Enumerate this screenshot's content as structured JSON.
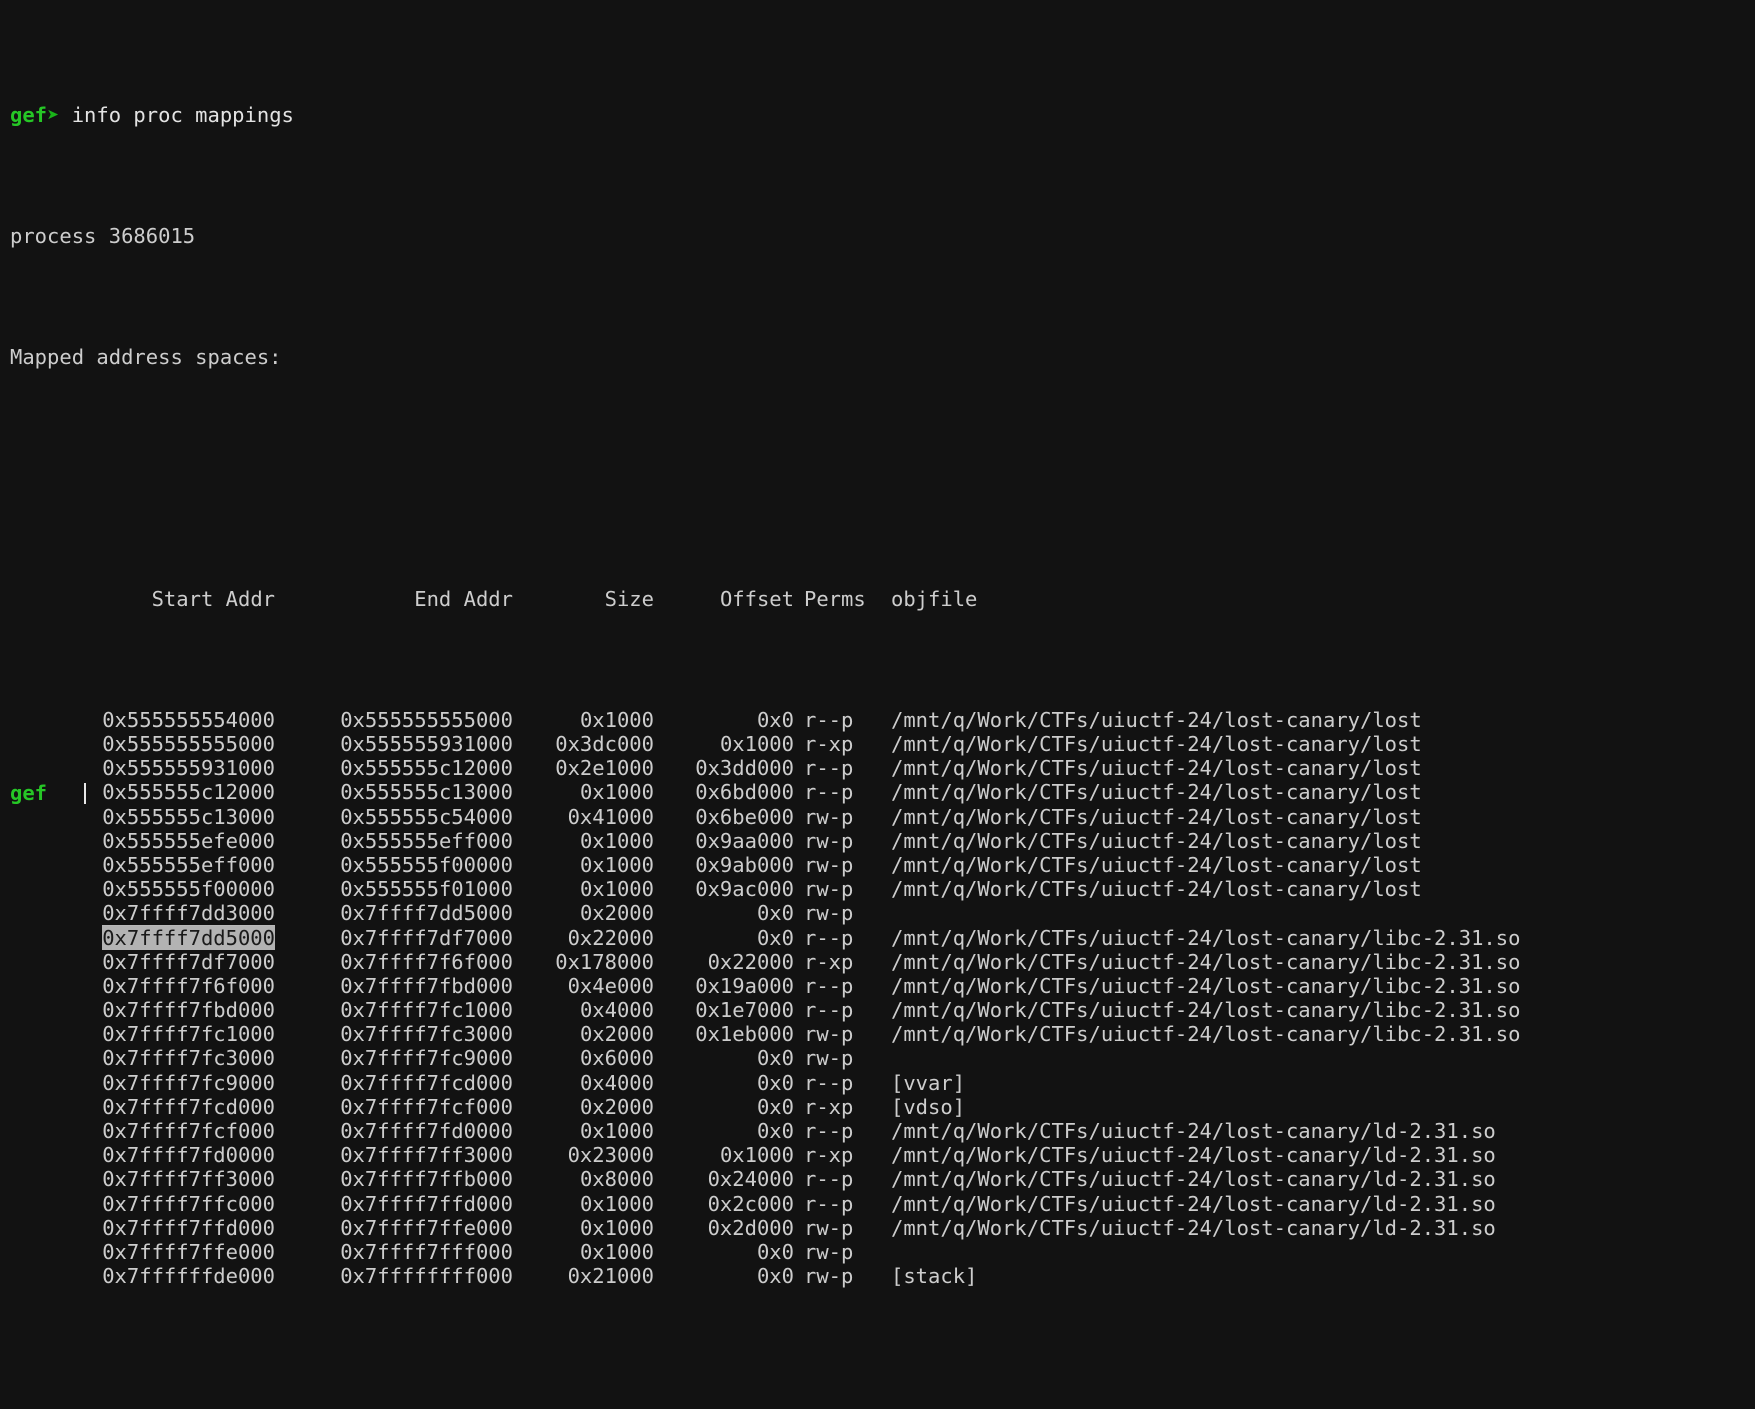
{
  "terminal": {
    "title": "gdb gef terminal",
    "background_color": "#121212",
    "foreground_color": "#cdcdcd",
    "prompt_color": "#26c726",
    "selection_color": "#b3b3b3",
    "prompt": {
      "label": "gef",
      "arrow": "➤",
      "command": "info proc mappings"
    },
    "output": {
      "process_line": "process 3686015",
      "mapped_header": "Mapped address spaces:",
      "blank_line": ""
    },
    "columns": {
      "start": "Start Addr",
      "end": "End Addr",
      "size": "Size",
      "offset": "Offset",
      "perms": "Perms",
      "objfile": "objfile"
    },
    "rows": [
      {
        "start": "0x555555554000",
        "end": "0x555555555000",
        "size": "0x1000",
        "offset": "0x0",
        "perms": "r--p",
        "objfile": "/mnt/q/Work/CTFs/uiuctf-24/lost-canary/lost"
      },
      {
        "start": "0x555555555000",
        "end": "0x555555931000",
        "size": "0x3dc000",
        "offset": "0x1000",
        "perms": "r-xp",
        "objfile": "/mnt/q/Work/CTFs/uiuctf-24/lost-canary/lost"
      },
      {
        "start": "0x555555931000",
        "end": "0x555555c12000",
        "size": "0x2e1000",
        "offset": "0x3dd000",
        "perms": "r--p",
        "objfile": "/mnt/q/Work/CTFs/uiuctf-24/lost-canary/lost"
      },
      {
        "start": "0x555555c12000",
        "end": "0x555555c13000",
        "size": "0x1000",
        "offset": "0x6bd000",
        "perms": "r--p",
        "objfile": "/mnt/q/Work/CTFs/uiuctf-24/lost-canary/lost"
      },
      {
        "start": "0x555555c13000",
        "end": "0x555555c54000",
        "size": "0x41000",
        "offset": "0x6be000",
        "perms": "rw-p",
        "objfile": "/mnt/q/Work/CTFs/uiuctf-24/lost-canary/lost"
      },
      {
        "start": "0x555555efe000",
        "end": "0x555555eff000",
        "size": "0x1000",
        "offset": "0x9aa000",
        "perms": "rw-p",
        "objfile": "/mnt/q/Work/CTFs/uiuctf-24/lost-canary/lost"
      },
      {
        "start": "0x555555eff000",
        "end": "0x555555f00000",
        "size": "0x1000",
        "offset": "0x9ab000",
        "perms": "rw-p",
        "objfile": "/mnt/q/Work/CTFs/uiuctf-24/lost-canary/lost"
      },
      {
        "start": "0x555555f00000",
        "end": "0x555555f01000",
        "size": "0x1000",
        "offset": "0x9ac000",
        "perms": "rw-p",
        "objfile": "/mnt/q/Work/CTFs/uiuctf-24/lost-canary/lost"
      },
      {
        "start": "0x7ffff7dd3000",
        "end": "0x7ffff7dd5000",
        "size": "0x2000",
        "offset": "0x0",
        "perms": "rw-p",
        "objfile": "",
        "start_underlined": true
      },
      {
        "start": "0x7ffff7dd5000",
        "end": "0x7ffff7df7000",
        "size": "0x22000",
        "offset": "0x0",
        "perms": "r--p",
        "objfile": "/mnt/q/Work/CTFs/uiuctf-24/lost-canary/libc-2.31.so",
        "start_selected": true
      },
      {
        "start": "0x7ffff7df7000",
        "end": "0x7ffff7f6f000",
        "size": "0x178000",
        "offset": "0x22000",
        "perms": "r-xp",
        "objfile": "/mnt/q/Work/CTFs/uiuctf-24/lost-canary/libc-2.31.so"
      },
      {
        "start": "0x7ffff7f6f000",
        "end": "0x7ffff7fbd000",
        "size": "0x4e000",
        "offset": "0x19a000",
        "perms": "r--p",
        "objfile": "/mnt/q/Work/CTFs/uiuctf-24/lost-canary/libc-2.31.so"
      },
      {
        "start": "0x7ffff7fbd000",
        "end": "0x7ffff7fc1000",
        "size": "0x4000",
        "offset": "0x1e7000",
        "perms": "r--p",
        "objfile": "/mnt/q/Work/CTFs/uiuctf-24/lost-canary/libc-2.31.so"
      },
      {
        "start": "0x7ffff7fc1000",
        "end": "0x7ffff7fc3000",
        "size": "0x2000",
        "offset": "0x1eb000",
        "perms": "rw-p",
        "objfile": "/mnt/q/Work/CTFs/uiuctf-24/lost-canary/libc-2.31.so"
      },
      {
        "start": "0x7ffff7fc3000",
        "end": "0x7ffff7fc9000",
        "size": "0x6000",
        "offset": "0x0",
        "perms": "rw-p",
        "objfile": ""
      },
      {
        "start": "0x7ffff7fc9000",
        "end": "0x7ffff7fcd000",
        "size": "0x4000",
        "offset": "0x0",
        "perms": "r--p",
        "objfile": "[vvar]"
      },
      {
        "start": "0x7ffff7fcd000",
        "end": "0x7ffff7fcf000",
        "size": "0x2000",
        "offset": "0x0",
        "perms": "r-xp",
        "objfile": "[vdso]"
      },
      {
        "start": "0x7ffff7fcf000",
        "end": "0x7ffff7fd0000",
        "size": "0x1000",
        "offset": "0x0",
        "perms": "r--p",
        "objfile": "/mnt/q/Work/CTFs/uiuctf-24/lost-canary/ld-2.31.so"
      },
      {
        "start": "0x7ffff7fd0000",
        "end": "0x7ffff7ff3000",
        "size": "0x23000",
        "offset": "0x1000",
        "perms": "r-xp",
        "objfile": "/mnt/q/Work/CTFs/uiuctf-24/lost-canary/ld-2.31.so"
      },
      {
        "start": "0x7ffff7ff3000",
        "end": "0x7ffff7ffb000",
        "size": "0x8000",
        "offset": "0x24000",
        "perms": "r--p",
        "objfile": "/mnt/q/Work/CTFs/uiuctf-24/lost-canary/ld-2.31.so"
      },
      {
        "start": "0x7ffff7ffc000",
        "end": "0x7ffff7ffd000",
        "size": "0x1000",
        "offset": "0x2c000",
        "perms": "r--p",
        "objfile": "/mnt/q/Work/CTFs/uiuctf-24/lost-canary/ld-2.31.so"
      },
      {
        "start": "0x7ffff7ffd000",
        "end": "0x7ffff7ffe000",
        "size": "0x1000",
        "offset": "0x2d000",
        "perms": "rw-p",
        "objfile": "/mnt/q/Work/CTFs/uiuctf-24/lost-canary/ld-2.31.so"
      },
      {
        "start": "0x7ffff7ffe000",
        "end": "0x7ffff7fff000",
        "size": "0x1000",
        "offset": "0x0",
        "perms": "rw-p",
        "objfile": ""
      },
      {
        "start": "0x7ffffffde000",
        "end": "0x7ffffffff000",
        "size": "0x21000",
        "offset": "0x0",
        "perms": "rw-p",
        "objfile": "[stack]"
      }
    ],
    "next_prompt": {
      "label": "gef",
      "cursor": "|"
    }
  }
}
